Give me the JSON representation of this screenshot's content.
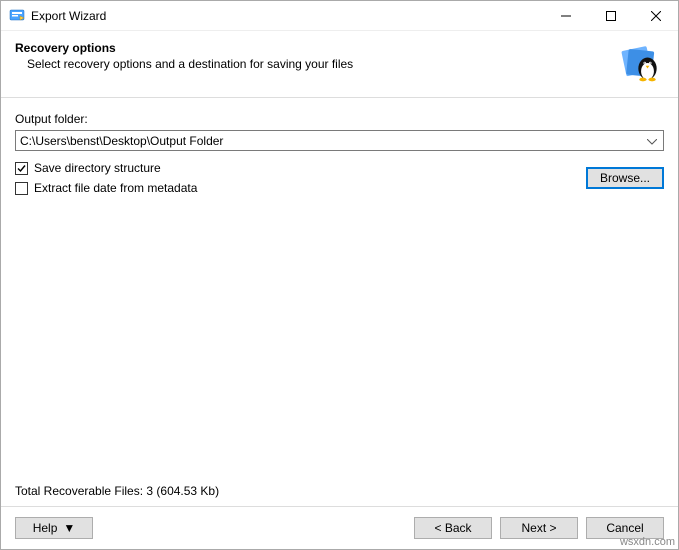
{
  "window": {
    "title": "Export Wizard"
  },
  "header": {
    "title": "Recovery options",
    "subtitle": "Select recovery options and a destination for saving your files"
  },
  "form": {
    "output_folder_label": "Output folder:",
    "output_folder_value": "C:\\Users\\benst\\Desktop\\Output Folder",
    "save_directory_structure_label": "Save directory structure",
    "save_directory_structure_checked": true,
    "extract_file_date_label": "Extract file date from metadata",
    "extract_file_date_checked": false,
    "browse_label": "Browse..."
  },
  "status": {
    "text": "Total Recoverable Files: 3 (604.53 Kb)"
  },
  "footer": {
    "help_label": "Help",
    "back_label": "< Back",
    "next_label": "Next >",
    "cancel_label": "Cancel"
  },
  "watermark": "wsxdn.com"
}
